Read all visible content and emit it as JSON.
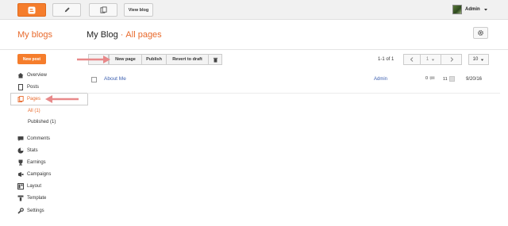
{
  "topbar": {
    "view_blog": "View blog",
    "user": "Admin"
  },
  "header": {
    "section": "My blogs",
    "blog_title": "My Blog",
    "separator": "·",
    "page_title": "All pages"
  },
  "sidebar": {
    "new_post": "New post",
    "items": [
      {
        "label": "Overview",
        "icon": "house-icon"
      },
      {
        "label": "Posts",
        "icon": "document-icon"
      },
      {
        "label": "Pages",
        "icon": "pages-icon"
      },
      {
        "label": "Comments",
        "icon": "comment-icon"
      },
      {
        "label": "Stats",
        "icon": "pie-chart-icon"
      },
      {
        "label": "Earnings",
        "icon": "trophy-icon"
      },
      {
        "label": "Campaigns",
        "icon": "campaign-icon"
      },
      {
        "label": "Layout",
        "icon": "layout-icon"
      },
      {
        "label": "Template",
        "icon": "template-icon"
      },
      {
        "label": "Settings",
        "icon": "wrench-icon"
      }
    ],
    "sub_items": [
      {
        "label": "All (1)",
        "active": true
      },
      {
        "label": "Published (1)",
        "active": false
      }
    ]
  },
  "toolbar": {
    "new_page": "New page",
    "publish": "Publish",
    "revert": "Revert to draft",
    "pagination_text": "1-1 of 1",
    "page_select": "1",
    "per_page": "10"
  },
  "rows": [
    {
      "title": "About Me",
      "author": "Admin",
      "comments": "0",
      "views": "11",
      "date": "9/20/16"
    }
  ],
  "colors": {
    "accent": "#f57d2c",
    "link": "#3c5fb0",
    "arrow": "#e8898a"
  }
}
